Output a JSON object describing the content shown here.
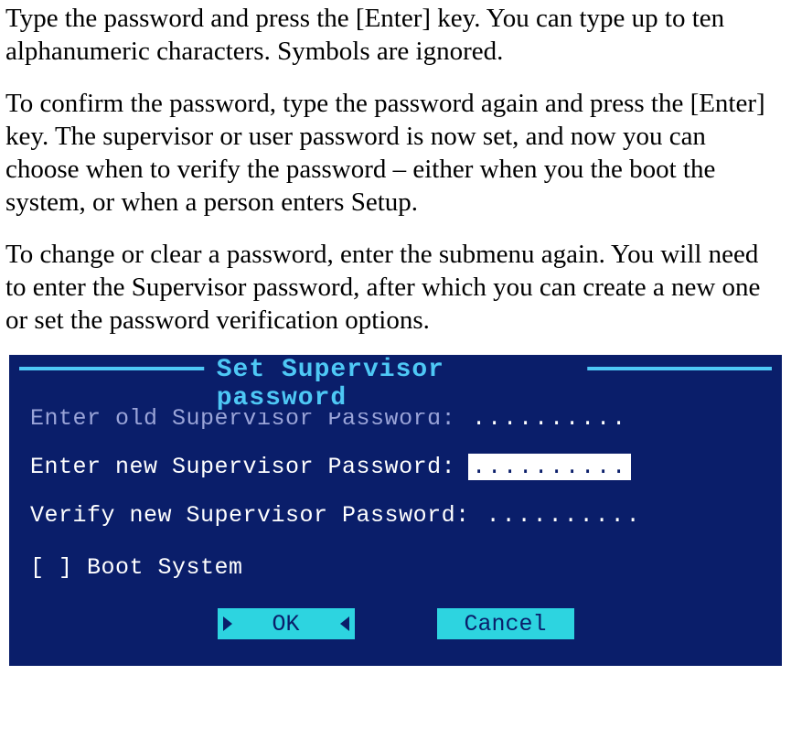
{
  "instructions": {
    "p1": "Type the password and press the [Enter] key. You can type up to ten alphanumeric characters. Symbols are ignored.",
    "p2": "To confirm the password, type the password again and press the [Enter] key. The supervisor or user password is now set, and now you can choose when to verify the password – either when you the boot the system, or when a person enters Setup.",
    "p3": "To change or clear a password, enter the submenu again. You will need to enter the Supervisor password, after which you can create a new one or set the password verification options."
  },
  "bios": {
    "title": "Set Supervisor password",
    "row_old_label": "Enter old Supervisor Password:",
    "row_new_label": "Enter new Supervisor Password:",
    "row_verify_label": "Verify new Supervisor Password:",
    "dots_value": "..........",
    "boot_label": "[ ] Boot System",
    "ok_label": "OK",
    "cancel_label": "Cancel"
  }
}
